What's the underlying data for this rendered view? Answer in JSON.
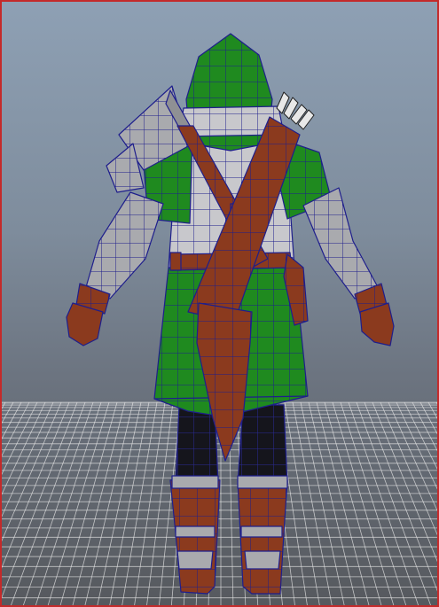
{
  "viewport": {
    "label": "",
    "highlight_color": "#c42a2a",
    "background_top": "#8ea0b4",
    "background_bottom": "#56595e",
    "grid_color": "#e6e6e6"
  },
  "model": {
    "display_mode": "wireframe-on-shaded",
    "view": "back",
    "wire_color": "#1e1e8c",
    "colors": {
      "cloth": "#1f8a1f",
      "leather": "#8b3a1e",
      "metal": "#a9aaae",
      "pants": "#15151c",
      "skin": "#b0b0b4",
      "arrow_fletching": "#e8e8e8"
    }
  }
}
